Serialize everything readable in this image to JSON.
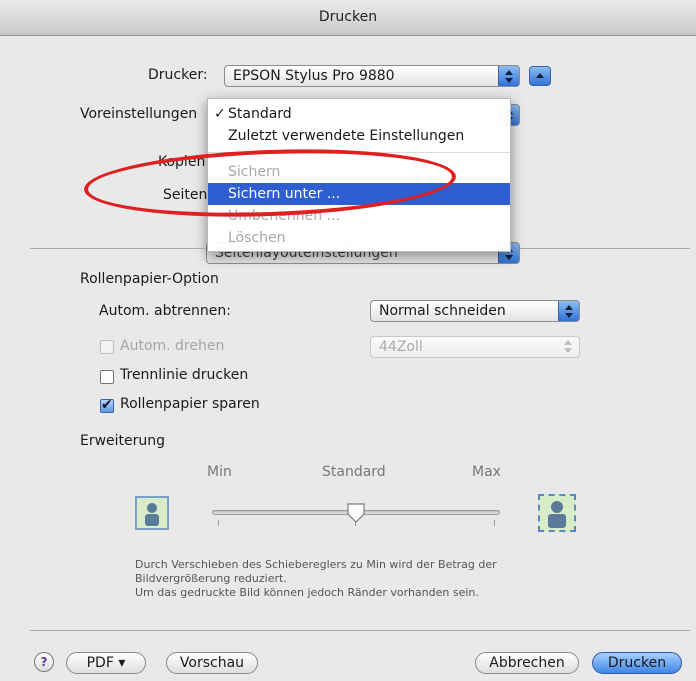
{
  "window": {
    "title": "Drucken"
  },
  "printer": {
    "label": "Drucker:",
    "value": "EPSON Stylus Pro 9880"
  },
  "presets": {
    "label": "Voreinstellungen",
    "menu_items": [
      {
        "label": "Standard",
        "checked": true
      },
      {
        "label": "Zuletzt verwendete Einstellungen"
      },
      {
        "label": "Sichern",
        "disabled": true
      },
      {
        "label": "Sichern unter ...",
        "selected": true
      },
      {
        "label": "Umbenennen ...",
        "disabled": true
      },
      {
        "label": "Löschen",
        "disabled": true
      }
    ]
  },
  "copies": {
    "label": "Kopien"
  },
  "pages": {
    "label": "Seiten"
  },
  "panel_popup": {
    "value": "Seitenlayouteinstellungen"
  },
  "roll": {
    "heading": "Rollenpapier-Option",
    "auto_cut_label": "Autom. abtrennen:",
    "auto_cut_value": "Normal schneiden",
    "auto_rotate_label": "Autom. drehen",
    "auto_rotate_value": "44Zoll",
    "print_cutline_label": "Trennlinie drucken",
    "save_paper_label": "Rollenpapier sparen"
  },
  "expansion": {
    "heading": "Erweiterung",
    "min": "Min",
    "standard": "Standard",
    "max": "Max",
    "level": 0.5,
    "note_line1": "Durch Verschieben des Schiebereglers zu Min wird der Betrag der",
    "note_line2": "Bildvergrößerung reduziert.",
    "note_line3": "Um das gedruckte Bild können jedoch Ränder vorhanden sein."
  },
  "buttons": {
    "help": "?",
    "pdf": "PDF ▾",
    "preview": "Vorschau",
    "cancel": "Abbrechen",
    "print": "Drucken"
  },
  "colors": {
    "accent": "#2f5ed1",
    "annotation": "#e02020"
  }
}
